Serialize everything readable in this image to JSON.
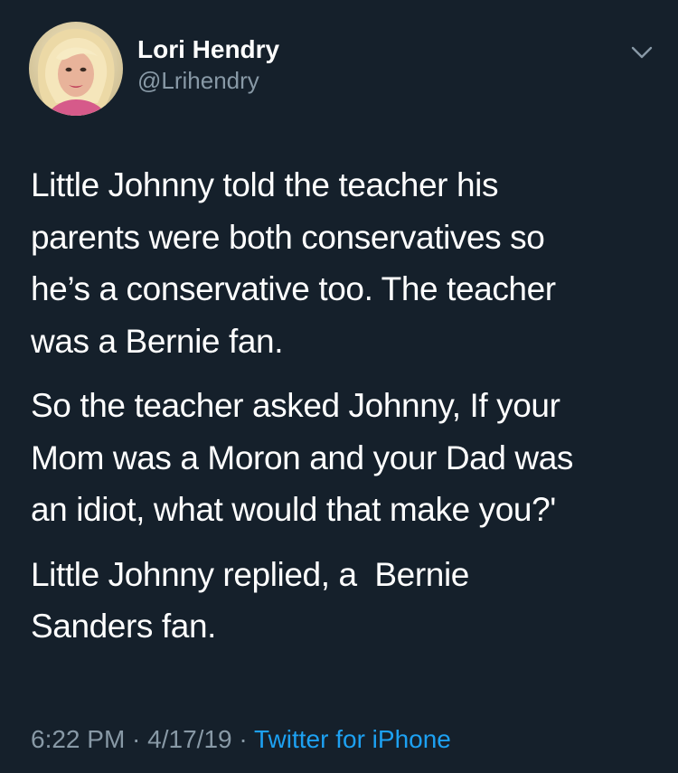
{
  "author": {
    "display_name": "Lori Hendry",
    "handle": "@Lrihendry"
  },
  "tweet": {
    "paragraphs": [
      "Little Johnny told the teacher his\nparents were both conservatives so\nhe’s a conservative too. The teacher\nwas a Bernie fan.",
      "So the teacher asked Johnny, If your\nMom was a Moron and your Dad was\nan idiot, what would that make you?'",
      "Little Johnny replied, a  Bernie\nSanders fan."
    ]
  },
  "meta": {
    "time": "6:22 PM",
    "sep1": " · ",
    "date": "4/17/19",
    "sep2": " · ",
    "source": "Twitter for iPhone"
  },
  "icons": {
    "menu": "chevron-down-icon",
    "avatar": "avatar"
  },
  "colors": {
    "background": "#15202b",
    "text": "#ffffff",
    "secondary_text": "#8899a6",
    "link": "#1da1f2"
  }
}
